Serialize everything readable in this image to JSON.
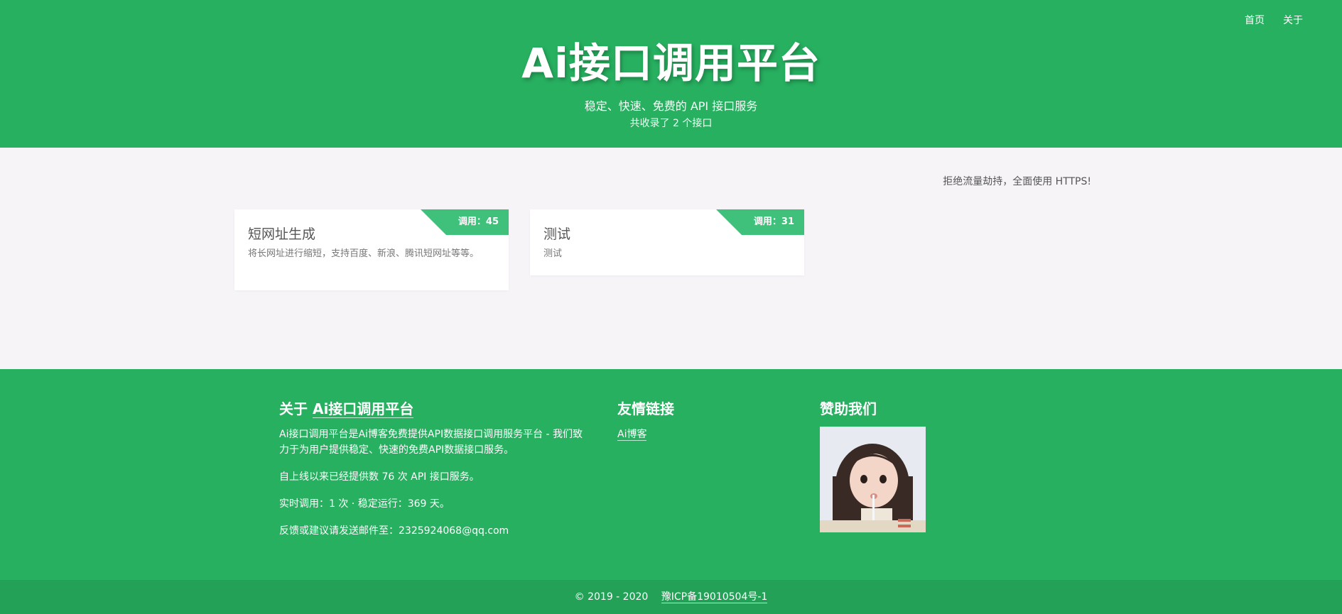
{
  "nav": {
    "home": "首页",
    "about": "关于"
  },
  "hero": {
    "title": "Ai接口调用平台",
    "subtitle": "稳定、快速、免费的 API 接口服务",
    "count": "共收录了 2 个接口"
  },
  "main": {
    "notice": "拒绝流量劫持，全面使用 HTTPS!",
    "cards": [
      {
        "title": "短网址生成",
        "desc": "将长网址进行缩短，支持百度、新浪、腾讯短网址等等。",
        "calls": "调用：45"
      },
      {
        "title": "测试",
        "desc": "测试",
        "calls": "调用：31"
      }
    ]
  },
  "footer": {
    "about": {
      "title_prefix": "关于 ",
      "title_brand": "Ai接口调用平台",
      "p1": "Ai接口调用平台是Ai博客免费提供API数据接口调用服务平台 - 我们致力于为用户提供稳定、快速的免费API数据接口服务。",
      "p2": "自上线以来已经提供数 76 次 API 接口服务。",
      "p3": "实时调用：1 次 · 稳定运行：369 天。",
      "p4": "反馈或建议请发送邮件至：2325924068@qq.com"
    },
    "links": {
      "title": "友情链接",
      "item": "Ai博客"
    },
    "sponsor": {
      "title": "赞助我们"
    }
  },
  "bottom": {
    "copyright": "© 2019 - 2020",
    "icp": "豫ICP备19010504号-1"
  },
  "colors": {
    "brand": "#27b060",
    "ribbon": "#3fc07b",
    "bottom": "#23a257",
    "background": "#f6f4f7"
  }
}
